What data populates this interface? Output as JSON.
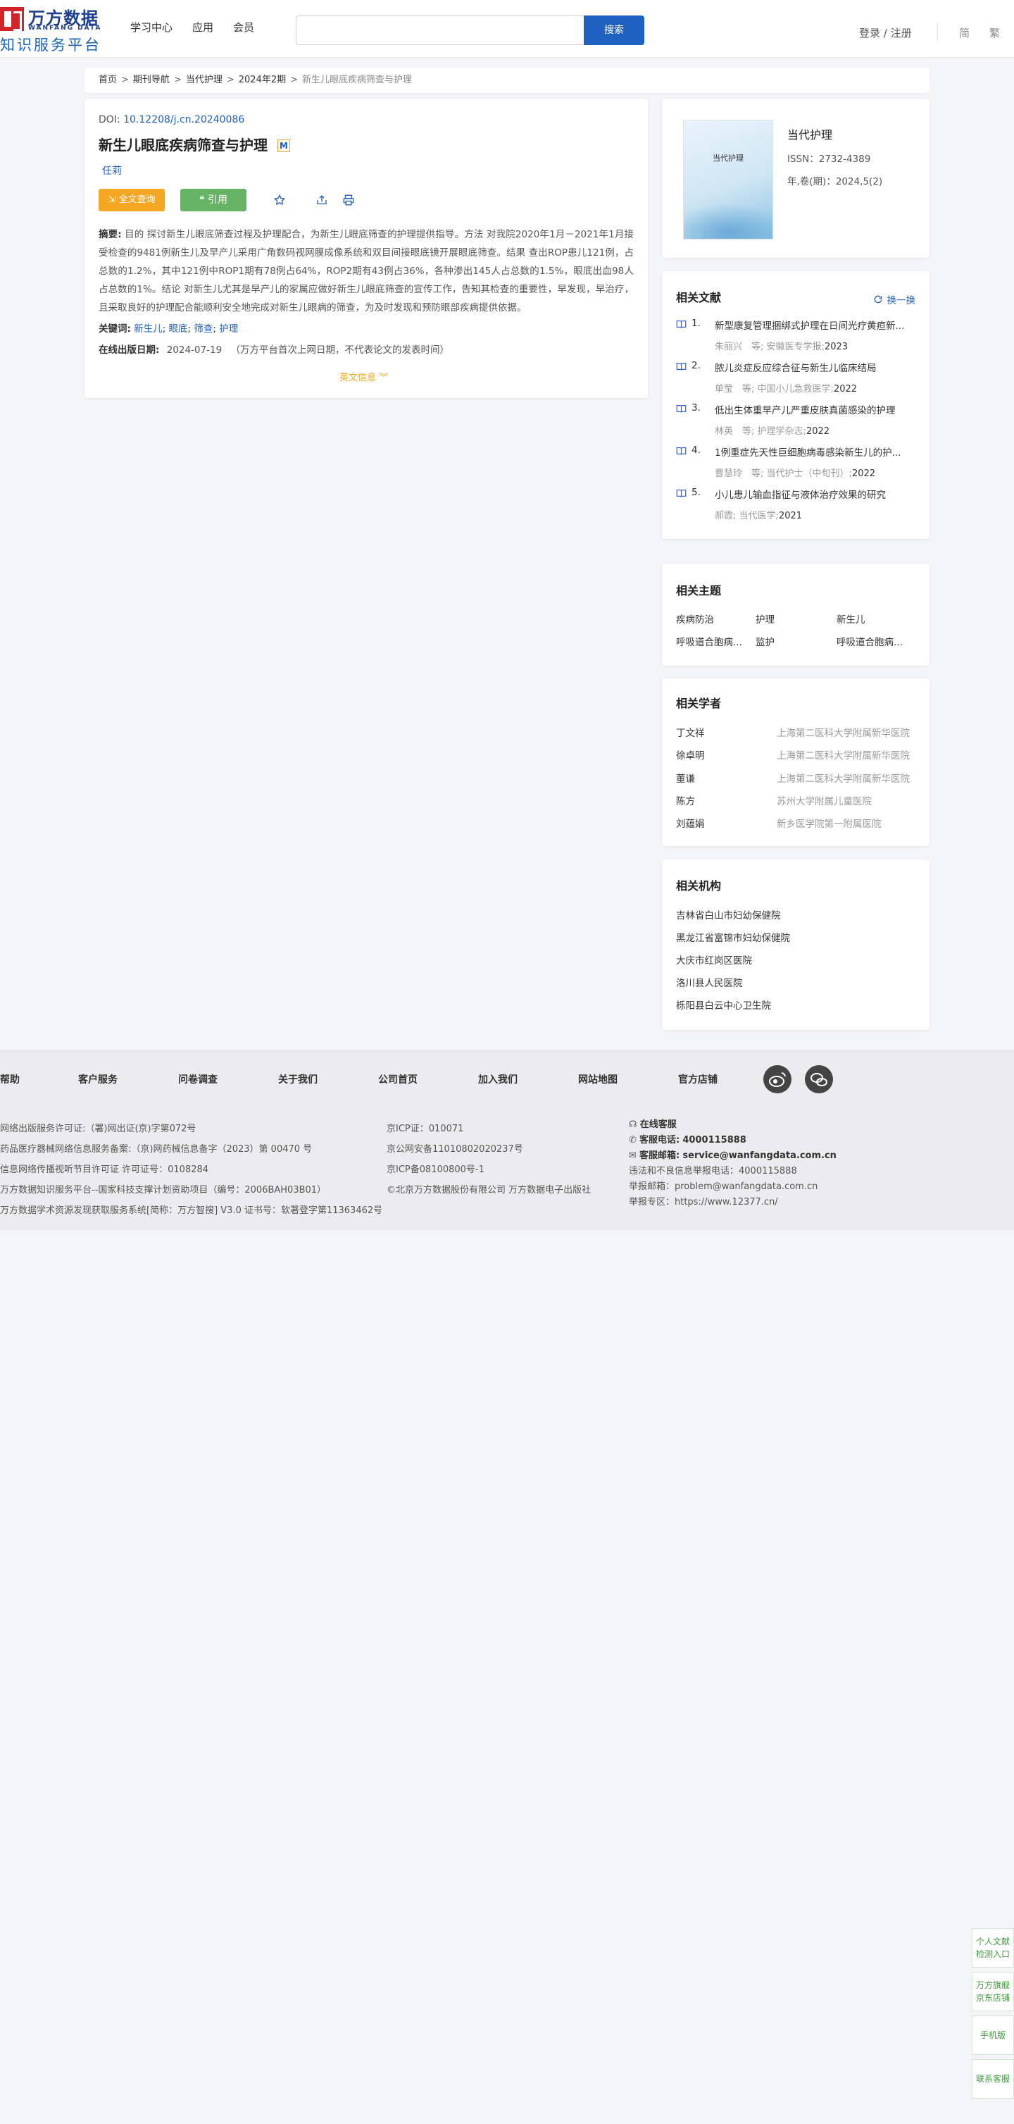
{
  "header": {
    "logo_cn": "万方数据",
    "logo_en": "WANFANG DATA",
    "logo_sub": "知识服务平台",
    "nav": [
      "学习中心",
      "应用",
      "会员"
    ],
    "search_placeholder": "",
    "search_button": "搜索",
    "login": "登录 / 注册",
    "lang_simplified": "简",
    "lang_traditional": "繁"
  },
  "breadcrumb": [
    "首页",
    "期刊导航",
    "当代护理",
    "2024年2期",
    "新生儿眼底疾病筛查与护理"
  ],
  "article": {
    "doi_label": "DOI: ",
    "doi": "10.12208/j.cn.20240086",
    "title": "新生儿眼底疾病筛查与护理",
    "badge": "M",
    "author": "任莉",
    "fulltext_button": "全文查询",
    "cite_button": "引用",
    "abstract_label": "摘要:",
    "abstract": " 目的 探讨新生儿眼底筛查过程及护理配合，为新生儿眼底筛查的护理提供指导。方法 对我院2020年1月－2021年1月接受检查的9481例新生儿及早产儿采用广角数码视网膜成像系统和双目间接眼底镜开展眼底筛查。结果 查出ROP患儿121例，占总数的1.2%，其中121例中ROP1期有78例占64%，ROP2期有43例占36%，各种渗出145人占总数的1.5%，眼底出血98人占总数的1%。结论 对新生儿尤其是早产儿的家属应做好新生儿眼底筛查的宣传工作，告知其检查的重要性，早发现，早治疗，且采取良好的护理配合能顺利安全地完成对新生儿眼病的筛查，为及时发现和预防眼部疾病提供依据。",
    "keywords_label": "关键词:",
    "keywords": [
      "新生儿",
      "眼底",
      "筛查",
      "护理"
    ],
    "pubdate_label": "在线出版日期:",
    "pubdate": "2024-07-19",
    "pubdate_note": "（万方平台首次上网日期，不代表论文的发表时间）",
    "en_info": "英文信息"
  },
  "journal": {
    "cover_title": "当代护理",
    "name": "当代护理",
    "issn": "ISSN：2732-4389",
    "volume": "年,卷(期)：2024,5(2)"
  },
  "related_literature": {
    "title": "相关文献",
    "refresh": "换一换",
    "items": [
      {
        "num": "1.",
        "title": "新型康复管理捆绑式护理在日间光疗黄疸新...",
        "authors": "朱丽兴　等;",
        "source": "安徽医专学报",
        "year": "2023"
      },
      {
        "num": "2.",
        "title": "脓儿炎症反应综合征与新生儿临床结局",
        "authors": "单莹　等;",
        "source": "中国小儿急救医学",
        "year": "2022"
      },
      {
        "num": "3.",
        "title": "低出生体重早产儿严重皮肤真菌感染的护理",
        "authors": "林英　等;",
        "source": "护理学杂志",
        "year": "2022"
      },
      {
        "num": "4.",
        "title": "1例重症先天性巨细胞病毒感染新生儿的护...",
        "authors": "曹慧玲　等;",
        "source": "当代护士（中旬刊）",
        "year": "2022"
      },
      {
        "num": "5.",
        "title": "小儿患儿输血指征与液体治疗效果的研究",
        "authors": "郝霞;",
        "source": "当代医学",
        "year": "2021"
      }
    ]
  },
  "related_topics": {
    "title": "相关主题",
    "items": [
      "疾病防治",
      "护理",
      "新生儿",
      "呼吸道合胞病...",
      "监护",
      "呼吸道合胞病..."
    ]
  },
  "related_scholars": {
    "title": "相关学者",
    "items": [
      {
        "name": "丁文祥",
        "org": "上海第二医科大学附属新华医院"
      },
      {
        "name": "徐卓明",
        "org": "上海第二医科大学附属新华医院"
      },
      {
        "name": "董谦",
        "org": "上海第二医科大学附属新华医院"
      },
      {
        "name": "陈方",
        "org": "苏州大学附属儿童医院"
      },
      {
        "name": "刘蕴娟",
        "org": "新乡医学院第一附属医院"
      }
    ]
  },
  "related_orgs": {
    "title": "相关机构",
    "items": [
      "吉林省白山市妇幼保健院",
      "黑龙江省富锦市妇幼保健院",
      "大庆市红岗区医院",
      "洛川县人民医院",
      "栎阳县白云中心卫生院"
    ]
  },
  "footer": {
    "links": [
      "帮助",
      "客户服务",
      "问卷调查",
      "关于我们",
      "公司首页",
      "加入我们",
      "网站地图",
      "官方店铺"
    ],
    "col1": [
      "网络出版服务许可证:（署)网出证(京)字第072号",
      "药品医疗器械网络信息服务备案:（京)网药械信息备字（2023）第 00470 号",
      "信息网络传播视听节目许可证 许可证号：0108284",
      "万方数据知识服务平台--国家科技支撑计划资助项目（编号：2006BAH03B01）",
      "万方数据学术资源发现获取服务系统[简称：万方智搜] V3.0 证书号：软著登字第11363462号"
    ],
    "col2": [
      "京ICP证：010071",
      "京公网安备11010802020237号",
      "京ICP备08100800号-1",
      "©北京万方数据股份有限公司 万方数据电子出版社"
    ],
    "online_service": "在线客服",
    "phone_label": "客服电话:",
    "phone": "4000115888",
    "email_label": "客服邮箱:",
    "email": "service@wanfangdata.com.cn",
    "report_phone": "违法和不良信息举报电话：4000115888",
    "report_email": "举报邮箱：problem@wanfangdata.com.cn",
    "report_zone": "举报专区：https://www.12377.cn/"
  },
  "side_tabs": [
    "个人文献检测入口",
    "万方旗舰京东店铺",
    "手机版",
    "联系客服"
  ],
  "colors": {
    "primary": "#1f5fbf",
    "orange": "#f5a623",
    "green": "#67b366",
    "brand_red": "#d3242a"
  }
}
